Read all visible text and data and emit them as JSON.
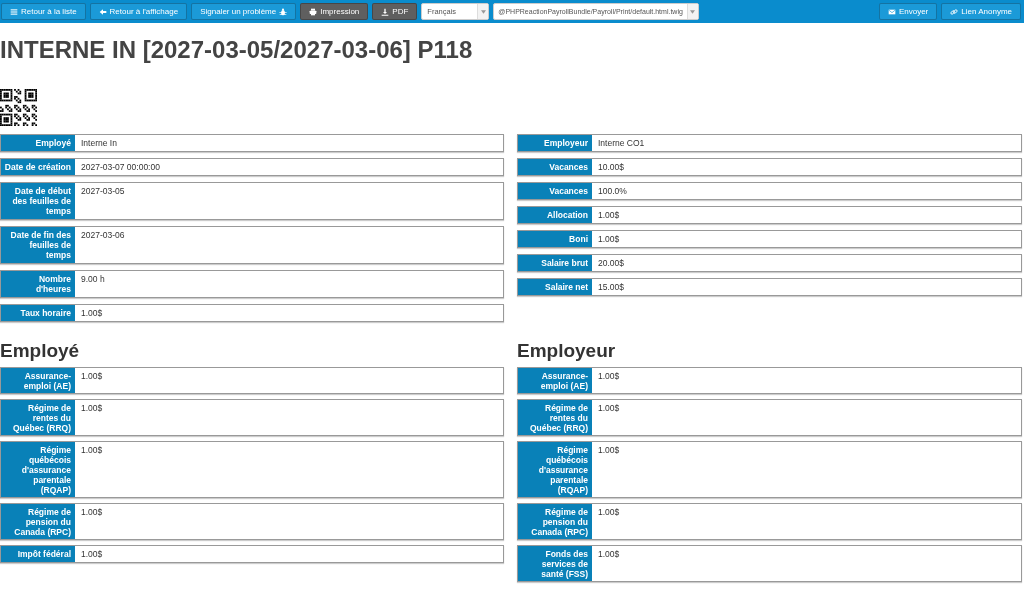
{
  "toolbar": {
    "left_buttons": [
      {
        "label": "Retour à la liste",
        "kind": "primary"
      },
      {
        "label": "Retour à l'affichage",
        "kind": "primary"
      },
      {
        "label": "Signaler un problème",
        "kind": "primary"
      },
      {
        "label": "Impression",
        "kind": "dark"
      },
      {
        "label": "PDF",
        "kind": "dark"
      }
    ],
    "language_select": {
      "value": "Français"
    },
    "template_select": {
      "value": "@PHPReactionPayrollBundle/Payroll/Print/default.html.twig"
    },
    "right_buttons": [
      {
        "label": "Envoyer",
        "kind": "primary"
      },
      {
        "label": "Lien Anonyme",
        "kind": "primary"
      }
    ]
  },
  "title": "INTERNE IN [2027-03-05/2027-03-06] P118",
  "summary_left": [
    {
      "label": "Employé",
      "value": "Interne In"
    },
    {
      "label": "Date de création",
      "value": "2027-03-07 00:00:00"
    },
    {
      "label": "Date de début des feuilles de temps",
      "value": "2027-03-05"
    },
    {
      "label": "Date de fin des feuilles de temps",
      "value": "2027-03-06"
    },
    {
      "label": "Nombre d'heures",
      "value": "9.00 h"
    },
    {
      "label": "Taux horaire",
      "value": "1.00$"
    }
  ],
  "summary_right": [
    {
      "label": "Employeur",
      "value": "Interne CO1"
    },
    {
      "label": "Vacances",
      "value": "10.00$"
    },
    {
      "label": "Vacances",
      "value": "100.0%"
    },
    {
      "label": "Allocation",
      "value": "1.00$"
    },
    {
      "label": "Boni",
      "value": "1.00$"
    },
    {
      "label": "Salaire brut",
      "value": "20.00$"
    },
    {
      "label": "Salaire net",
      "value": "15.00$"
    }
  ],
  "employee_section": {
    "heading": "Employé",
    "rows": [
      {
        "label": "Assurance-emploi (AE)",
        "value": "1.00$"
      },
      {
        "label": "Régime de rentes du Québec (RRQ)",
        "value": "1.00$"
      },
      {
        "label": "Régime québécois d'assurance parentale (RQAP)",
        "value": "1.00$"
      },
      {
        "label": "Régime de pension du Canada (RPC)",
        "value": "1.00$"
      },
      {
        "label": "Impôt fédéral",
        "value": "1.00$"
      }
    ]
  },
  "employer_section": {
    "heading": "Employeur",
    "rows": [
      {
        "label": "Assurance-emploi (AE)",
        "value": "1.00$"
      },
      {
        "label": "Régime de rentes du Québec (RRQ)",
        "value": "1.00$"
      },
      {
        "label": "Régime québécois d'assurance parentale (RQAP)",
        "value": "1.00$"
      },
      {
        "label": "Régime de pension du Canada (RPC)",
        "value": "1.00$"
      },
      {
        "label": "Fonds des services de santé (FSS)",
        "value": "1.00$"
      }
    ]
  }
}
